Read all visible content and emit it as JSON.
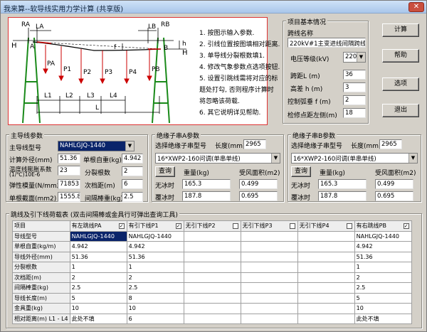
{
  "window": {
    "title": "我来算--软导线实用力学计算 (共享版)",
    "close_glyph": "✕"
  },
  "diagram": {
    "labels": {
      "RA": "RA",
      "LA": "LA",
      "LB": "LB",
      "RB": "RB",
      "H_left": "H",
      "H_right": "H",
      "A": "A",
      "B": "B",
      "f": "f",
      "h": "h",
      "PA": "PA",
      "P1": "P1",
      "P2": "P2",
      "P3": "P3",
      "P4": "P4",
      "PB": "PB",
      "L1": "L1",
      "L2": "L2",
      "L3": "L3",
      "L4": "L4",
      "L": "L"
    },
    "notes": [
      "1. 按图示输入参数.",
      "2. 引线位置按图填相对距离.",
      "3. 单导线分裂根数填1.",
      "4. 修改气象参数点选项按钮.",
      "5. 设置引跳线需将对应的标",
      "   题处打勾, 否则程序计算时",
      "   将忽略该荷载.",
      "6. 其它说明详见帮助."
    ]
  },
  "project": {
    "legend": "项目基本情况",
    "line_name_label": "跨线名称",
    "line_name": "220kV#1主变进线间隔跨线",
    "voltage_label": "电压等级(kV)",
    "voltage": "220",
    "span_label": "跨距L (m)",
    "span": "36",
    "height_label": "高差 h (m)",
    "height": "3",
    "sag_label": "控制弧垂 f (m)",
    "sag": "2",
    "check_label": "检修点距左侧(m)",
    "check": "18"
  },
  "buttons": {
    "calc": "计算",
    "help": "帮助",
    "options": "选项",
    "exit": "退出"
  },
  "conductor": {
    "legend": "主导线参数",
    "type_label": "主导线型号",
    "type": "NAHLGJQ-1440",
    "od_label": "计算外径(mm)",
    "od": "51.36",
    "weight_label": "单根自重(kg)",
    "weight": "4.942",
    "tcoef_label1": "温度线膨胀系数",
    "tcoef_label2": "(1/℃)10E-6",
    "tcoef": "23",
    "split_label": "分裂根数",
    "split": "2",
    "modulus_label": "弹性模量(N/mm2)",
    "modulus": "71853",
    "subspan_label": "次档距(m)",
    "subspan": "6",
    "area_label": "单根截面(mm2)",
    "area": "1555.8",
    "spacer_label": "间隔棒重(kg)",
    "spacer": "2.5"
  },
  "insA": {
    "legend": "绝缘子串A参数",
    "sel_label": "选择绝缘子串型号",
    "len_label": "长度(mm)",
    "len": "2965",
    "type": "16*XWP2-160问调(单串单线)",
    "query": "查询",
    "w_label": "重量(kg)",
    "wind_label": "受风面积(m2)",
    "noice": "无冰时",
    "ice": "覆冰时",
    "w_noice": "165.3",
    "wind_noice": "0.499",
    "w_ice": "187.8",
    "wind_ice": "0.695"
  },
  "insB": {
    "legend": "绝缘子串B参数",
    "sel_label": "选择绝缘子串型号",
    "len_label": "长度(mm)",
    "len": "2965",
    "type": "16*XWP2-160问调(单串单线)",
    "query": "查询",
    "w_label": "重量(kg)",
    "wind_label": "受风面积(m2)",
    "noice": "无冰时",
    "ice": "覆冰时",
    "w_noice": "165.3",
    "wind_noice": "0.499",
    "w_ice": "187.8",
    "wind_ice": "0.695"
  },
  "jump": {
    "legend": "跳线及引下线荷载表 (双击间隔棒或金具行可弹出查询工具)",
    "headers": [
      "项目",
      "有左跳线PA",
      "有引下线P1",
      "无引下线P2",
      "无引下线P3",
      "无引下线P4",
      "有右跳线PB"
    ],
    "checks": [
      "✓",
      "✓",
      "",
      "",
      "",
      "✓"
    ],
    "rows": [
      {
        "label": "导线型号",
        "cells": [
          "NAHLGJQ-1440",
          "NAHLGJQ-1440",
          "",
          "",
          "",
          "NAHLGJQ-1440"
        ]
      },
      {
        "label": "单根自重(kg/m)",
        "cells": [
          "4.942",
          "4.942",
          "",
          "",
          "",
          "4.942"
        ]
      },
      {
        "label": "导线外径(mm)",
        "cells": [
          "51.36",
          "51.36",
          "",
          "",
          "",
          "51.36"
        ]
      },
      {
        "label": "分裂根数",
        "cells": [
          "1",
          "1",
          "",
          "",
          "",
          "1"
        ]
      },
      {
        "label": "次档距(m)",
        "cells": [
          "2",
          "2",
          "",
          "",
          "",
          "2"
        ]
      },
      {
        "label": "间隔棒重(kg)",
        "cells": [
          "2.5",
          "2.5",
          "",
          "",
          "",
          "2.5"
        ]
      },
      {
        "label": "导线长度(m)",
        "cells": [
          "5",
          "8",
          "",
          "",
          "",
          "5"
        ]
      },
      {
        "label": "金具重(kg)",
        "cells": [
          "10",
          "10",
          "",
          "",
          "",
          "10"
        ]
      },
      {
        "label": "相对距离(m) L1 - L4",
        "cells": [
          "此处不填",
          "6",
          "",
          "",
          "",
          "此处不填"
        ]
      }
    ]
  }
}
